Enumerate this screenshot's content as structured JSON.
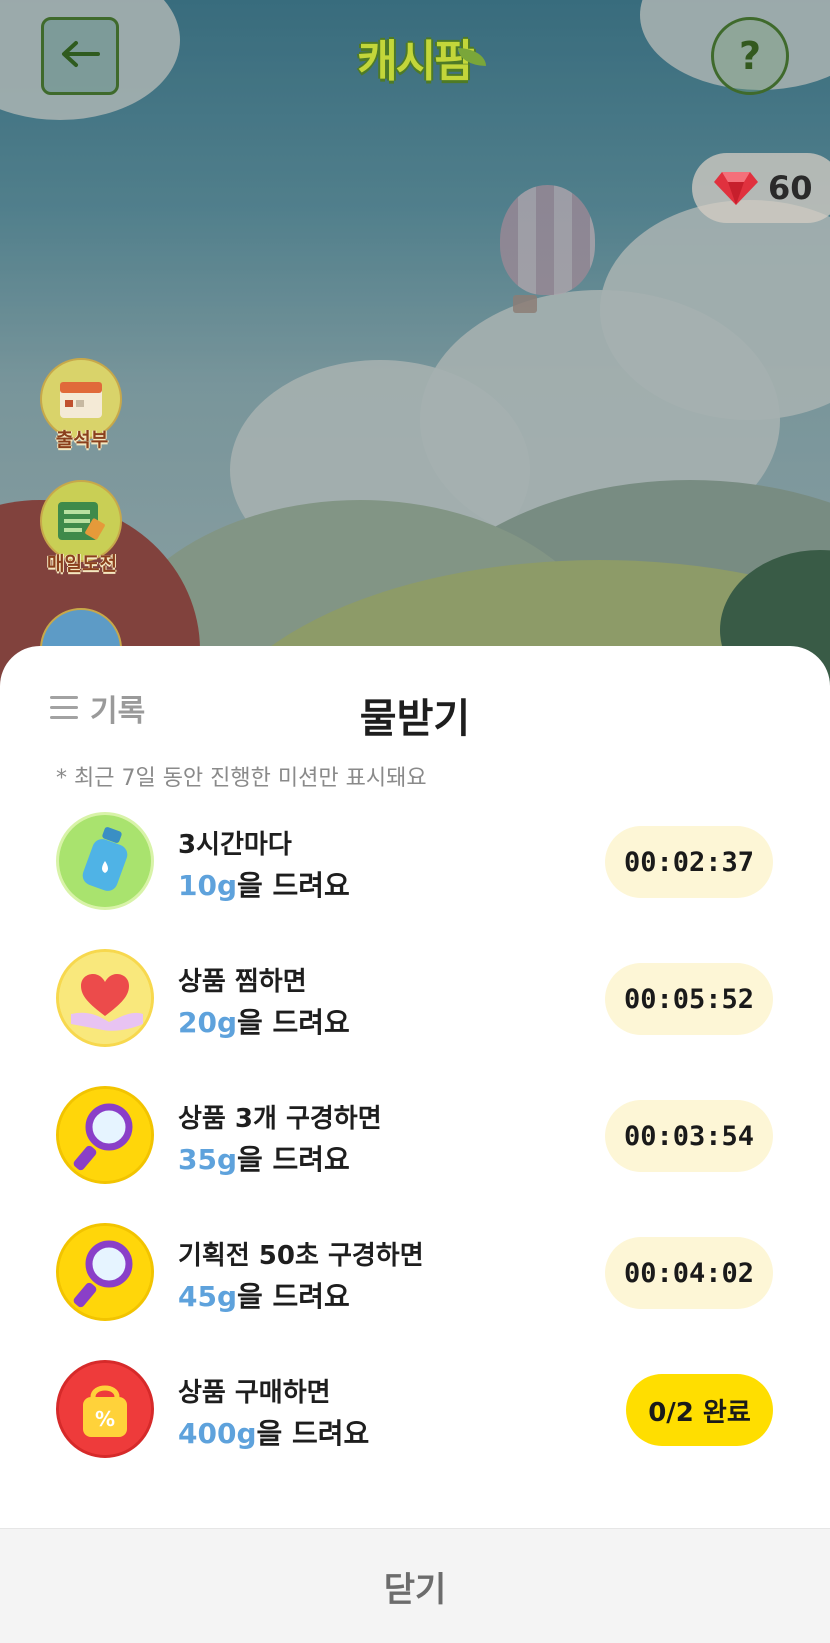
{
  "header": {
    "logo_text": "캐시팜",
    "back_icon": "arrow-left-icon",
    "help_label": "?",
    "gems": {
      "icon": "gem-icon",
      "count": "60"
    }
  },
  "side_menu": [
    {
      "label": "출석부",
      "icon": "calendar-icon"
    },
    {
      "label": "매일도전",
      "icon": "checklist-icon"
    }
  ],
  "sheet": {
    "history_label": "기록",
    "title": "물받기",
    "note": "* 최근 7일 동안 진행한 미션만 표시돼요",
    "missions": [
      {
        "icon": "water-bottle-icon",
        "title": "3시간마다",
        "amount": "10g",
        "suffix": "을 드려요",
        "status": "00:02:37"
      },
      {
        "icon": "heart-hand-icon",
        "title": "상품 찜하면",
        "amount": "20g",
        "suffix": "을 드려요",
        "status": "00:05:52"
      },
      {
        "icon": "magnifier-icon",
        "title": "상품 3개 구경하면",
        "amount": "35g",
        "suffix": "을 드려요",
        "status": "00:03:54"
      },
      {
        "icon": "magnifier-purple-icon",
        "title": "기획전 50초 구경하면",
        "amount": "45g",
        "suffix": "을 드려요",
        "status": "00:04:02"
      },
      {
        "icon": "shopping-bag-icon",
        "title": "상품 구매하면",
        "amount": "400g",
        "suffix": "을 드려요",
        "status": "0/2 완료"
      }
    ],
    "close_label": "닫기"
  },
  "colors": {
    "accent_blue": "#5ea2dc",
    "done_yellow": "#ffde00",
    "timer_bg": "#fdf6d6"
  }
}
